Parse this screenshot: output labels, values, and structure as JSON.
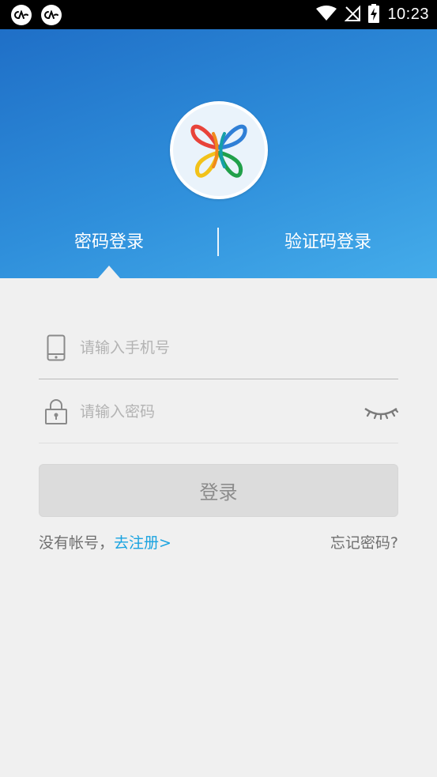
{
  "status_bar": {
    "time": "10:23",
    "icons": [
      "app-notification-icon",
      "app-notification-icon",
      "wifi-icon",
      "no-signal-icon",
      "battery-charging-icon"
    ]
  },
  "header": {
    "logo": "butterfly-logo",
    "tabs": [
      {
        "label": "密码登录",
        "active": true
      },
      {
        "label": "验证码登录",
        "active": false
      }
    ]
  },
  "form": {
    "phone": {
      "placeholder": "请输入手机号",
      "value": "",
      "icon": "phone-icon"
    },
    "password": {
      "placeholder": "请输入密码",
      "value": "",
      "icon": "lock-icon",
      "toggle_icon": "eye-closed-icon"
    },
    "login_button": "登录",
    "no_account_text": "没有帐号，",
    "register_link": "去注册>",
    "forgot_link": "忘记密码?"
  },
  "colors": {
    "header_gradient_start": "#1f6fc7",
    "header_gradient_end": "#44acea",
    "link": "#1aa3e0",
    "button_disabled_bg": "#dcdcdc",
    "background": "#f0f0f0"
  }
}
